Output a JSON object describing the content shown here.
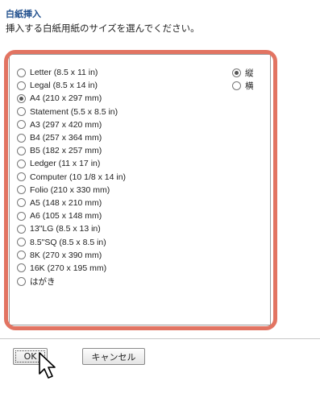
{
  "header": {
    "title": "白紙挿入",
    "instruction": "挿入する白紙用紙のサイズを選んでください。"
  },
  "paper_sizes": [
    {
      "label": "Letter (8.5 x 11 in)",
      "selected": false
    },
    {
      "label": "Legal (8.5 x 14 in)",
      "selected": false
    },
    {
      "label": "A4 (210 x 297 mm)",
      "selected": true
    },
    {
      "label": "Statement (5.5 x 8.5 in)",
      "selected": false
    },
    {
      "label": "A3 (297 x 420 mm)",
      "selected": false
    },
    {
      "label": "B4 (257 x 364 mm)",
      "selected": false
    },
    {
      "label": "B5 (182 x 257 mm)",
      "selected": false
    },
    {
      "label": "Ledger (11 x 17 in)",
      "selected": false
    },
    {
      "label": "Computer (10 1/8 x 14 in)",
      "selected": false
    },
    {
      "label": "Folio (210 x 330 mm)",
      "selected": false
    },
    {
      "label": "A5 (148 x 210 mm)",
      "selected": false
    },
    {
      "label": "A6 (105 x 148 mm)",
      "selected": false
    },
    {
      "label": "13\"LG (8.5 x 13 in)",
      "selected": false
    },
    {
      "label": "8.5\"SQ (8.5 x 8.5 in)",
      "selected": false
    },
    {
      "label": "8K (270 x 390 mm)",
      "selected": false
    },
    {
      "label": "16K (270 x 195 mm)",
      "selected": false
    },
    {
      "label": "はがき",
      "selected": false
    }
  ],
  "orientation": [
    {
      "label": "縦",
      "selected": true
    },
    {
      "label": "横",
      "selected": false
    }
  ],
  "buttons": {
    "ok": "OK",
    "cancel": "キャンセル"
  },
  "colors": {
    "highlight": "#e27462",
    "title": "#1f4e8c"
  },
  "icons": {
    "cursor": "mouse-pointer-icon"
  }
}
